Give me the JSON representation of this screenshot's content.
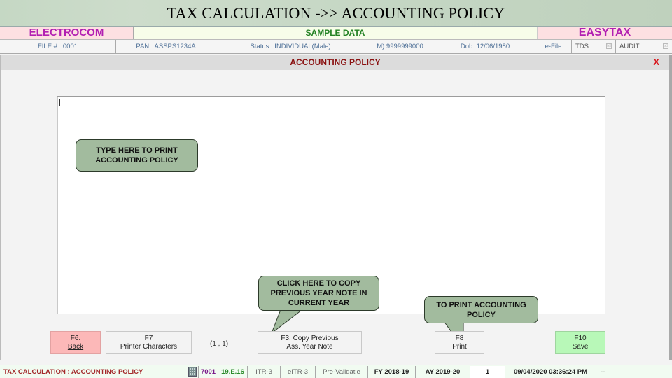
{
  "slide_title": "TAX CALCULATION ->> ACCOUNTING POLICY",
  "brand": {
    "left": "ELECTROCOM",
    "center": "SAMPLE DATA",
    "right": "EASYTAX"
  },
  "info": {
    "file": "FILE # : 0001",
    "pan": "PAN : ASSPS1234A",
    "status": "Status : INDIVIDUAL(Male)",
    "mobile": "M) 9999999000",
    "dob": "Dob: 12/06/1980",
    "efile": "e-File",
    "tds": "TDS",
    "audit": "AUDIT",
    "check_glyph": "☑"
  },
  "panel": {
    "title": "ACCOUNTING POLICY",
    "close": "X",
    "note_value": ""
  },
  "callouts": {
    "type_here": "TYPE HERE TO PRINT ACCOUNTING POLICY",
    "copy_prev": "CLICK HERE TO COPY PREVIOUS YEAR NOTE IN CURRENT YEAR",
    "print": "TO  PRINT ACCOUNTING POLICY"
  },
  "buttons": {
    "back": {
      "key": "F6.",
      "label": "Back"
    },
    "printer_chars": {
      "key": "F7",
      "label": "Printer Characters"
    },
    "copy_prev": {
      "key": "F3. Copy Previous",
      "label": "Ass. Year Note"
    },
    "print": {
      "key": "F8",
      "label": "Print"
    },
    "save": {
      "key": "F10",
      "label": "Save"
    }
  },
  "cursor_position": "(1 , 1)",
  "status_bar": {
    "module": "TAX CALCULATION : ACCOUNTING POLICY",
    "code": "7001",
    "version": "19.E.16",
    "itr": "ITR-3",
    "eitr": "eITR-3",
    "prevalidate": "Pre-Validatie",
    "fy": "FY 2018-19",
    "ay": "AY 2019-20",
    "page": "1",
    "datetime": "09/04/2020 03:36:24 PM",
    "extra": "--"
  },
  "colors": {
    "brand_magenta": "#b220b2",
    "sample_green": "#248224",
    "title_red": "#8a1111",
    "close_red": "#d8141a",
    "callout_green": "#a2bb9e",
    "back_pink": "#fcb8b8",
    "save_green": "#b8f8b8"
  }
}
